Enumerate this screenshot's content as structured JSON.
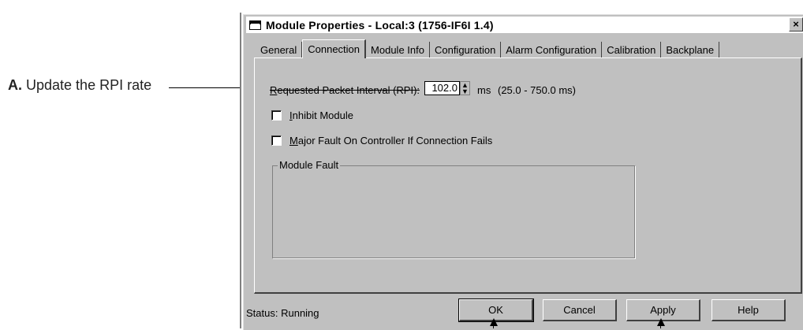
{
  "callout": {
    "letter": "A.",
    "text": "Update the RPI rate"
  },
  "window": {
    "title": "Module Properties - Local:3 (1756-IF6I 1.4)",
    "close_glyph": "×"
  },
  "tabs": [
    {
      "label": "General",
      "active": false
    },
    {
      "label": "Connection",
      "active": true
    },
    {
      "label": "Module Info",
      "active": false
    },
    {
      "label": "Configuration",
      "active": false
    },
    {
      "label": "Alarm Configuration",
      "active": false
    },
    {
      "label": "Calibration",
      "active": false
    },
    {
      "label": "Backplane",
      "active": false
    }
  ],
  "connection": {
    "rpi_label": "Requested Packet Interval (RPI):",
    "rpi_value": "102.0",
    "rpi_unit": "ms",
    "rpi_range": "(25.0 - 750.0 ms)",
    "inhibit_label": "Inhibit Module",
    "inhibit_checked": false,
    "major_fault_label": "Major Fault On Controller If Connection Fails",
    "major_fault_checked": false,
    "module_fault_label": "Module Fault"
  },
  "footer": {
    "status_label": "Status:",
    "status_value": "Running",
    "ok_label": "OK",
    "cancel_label": "Cancel",
    "apply_label": "Apply",
    "help_label": "Help"
  }
}
